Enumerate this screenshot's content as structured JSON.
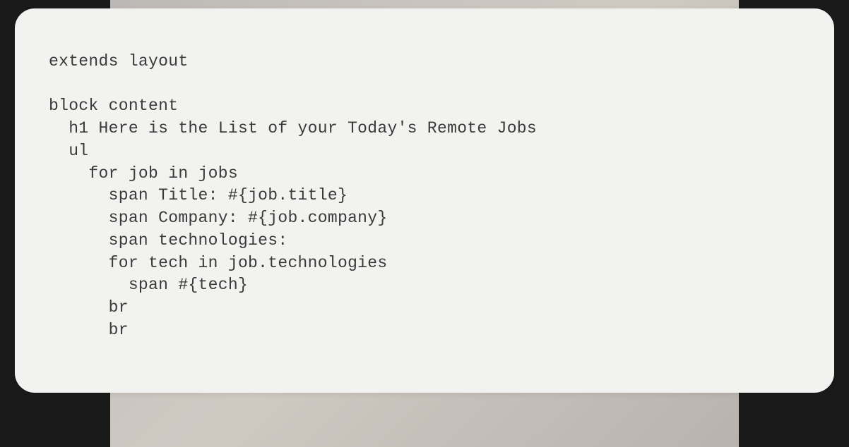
{
  "code": {
    "lines": [
      "extends layout",
      "",
      "block content",
      "  h1 Here is the List of your Today's Remote Jobs",
      "  ul",
      "    for job in jobs",
      "      span Title: #{job.title}",
      "      span Company: #{job.company}",
      "      span technologies:",
      "      for tech in job.technologies",
      "        span #{tech}",
      "      br",
      "      br"
    ]
  }
}
